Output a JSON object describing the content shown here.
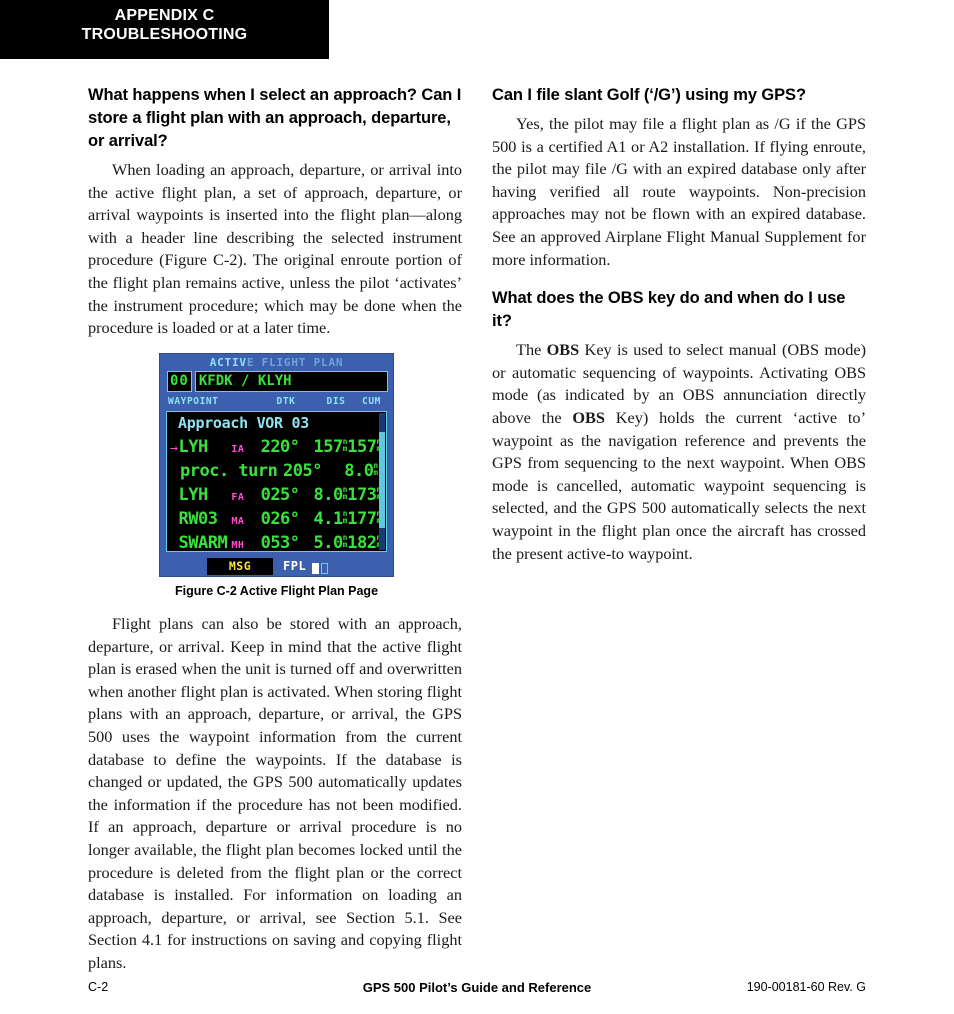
{
  "header": {
    "line1": "APPENDIX C",
    "line2": "TROUBLESHOOTING"
  },
  "left_column": {
    "heading1": "What happens when I select an approach? Can I store a flight plan with an approach, departure, or arrival?",
    "paragraph1": "When loading an approach, departure, or arrival into the active flight plan, a set of approach, departure, or arrival waypoints is inserted into the flight plan—along with a header line describing the selected instrument procedure (Figure C-2).  The original enroute portion of the flight plan remains active, unless the pilot ‘activates’ the instrument procedure; which may be done when the procedure is loaded or at a later time.",
    "paragraph2": "Flight plans can also be stored with an approach, departure, or arrival.  Keep in mind that the active flight plan is erased when the unit is turned off and overwritten when another flight plan is activated.  When storing flight plans with an approach, departure, or arrival, the GPS 500 uses the waypoint information from the current database to define the waypoints.  If the database is changed or updated, the GPS 500 automatically updates the information if the procedure has not been modified.  If an approach, departure or arrival procedure is no longer available, the flight plan becomes locked until the procedure is deleted from the flight plan or the correct database is installed.  For information on loading an approach, departure, or arrival, see Section 5.1.  See Section 4.1 for instructions on saving and copying flight plans."
  },
  "right_column": {
    "heading1": "Can I file slant Golf (‘/G’) using my GPS?",
    "paragraph1": "Yes, the pilot may file a flight plan as /G if the GPS 500 is a certified A1 or A2 installation.  If flying enroute, the pilot may file /G with an expired database only after having verified all route waypoints.   Non-precision approaches may not be flown with an expired database.  See an approved Airplane Flight Manual Supplement for more information.",
    "heading2": "What does the OBS key do and when do I use it?",
    "paragraph2_part1": "The ",
    "paragraph2_bold1": "OBS",
    "paragraph2_part2": " Key is used to select manual (OBS mode) or automatic sequencing of waypoints.  Activating OBS mode (as indicated by an OBS annunciation directly above the ",
    "paragraph2_bold2": "OBS",
    "paragraph2_part3": " Key) holds the current ‘active to’ waypoint as the navigation reference and prevents the GPS from sequencing to the next waypoint.  When OBS mode is cancelled, automatic waypoint sequencing is selected, and the GPS 500 automatically selects the next waypoint in the flight plan once the aircraft has crossed the present active-to waypoint."
  },
  "figure": {
    "caption": "Figure C-2  Active Flight Plan Page",
    "gps": {
      "title_active": "ACTIV",
      "title_rest": "E FLIGHT PLAN",
      "plan_number": "00",
      "route": "KFDK / KLYH",
      "columns": {
        "waypoint": "WAYPOINT",
        "dtk": "DTK",
        "dis": "DIS",
        "cum": "CUM"
      },
      "procedure_header": "Approach VOR 03",
      "rows": [
        {
          "arrow": "→",
          "waypoint": "LYH",
          "type": "IA",
          "dtk": "220°",
          "dis": "157",
          "dis_unit_top": "n",
          "dis_unit_bottom": "m",
          "cum": "157",
          "cum_unit_top": "n",
          "cum_unit_bottom": "m"
        },
        {
          "arrow": "",
          "waypoint": "proc. turn",
          "type": "",
          "dtk": "205°",
          "dis": "8.0",
          "dis_unit_top": "n",
          "dis_unit_bottom": "m",
          "cum": "",
          "cum_unit_top": "",
          "cum_unit_bottom": ""
        },
        {
          "arrow": "",
          "waypoint": "LYH",
          "type": "FA",
          "dtk": "025°",
          "dis": "8.0",
          "dis_unit_top": "n",
          "dis_unit_bottom": "m",
          "cum": "173",
          "cum_unit_top": "n",
          "cum_unit_bottom": "m"
        },
        {
          "arrow": "",
          "waypoint": "RW03",
          "type": "MA",
          "dtk": "026°",
          "dis": "4.1",
          "dis_unit_top": "n",
          "dis_unit_bottom": "m",
          "cum": "177",
          "cum_unit_top": "n",
          "cum_unit_bottom": "m"
        },
        {
          "arrow": "",
          "waypoint": "SWARM",
          "type": "MH",
          "dtk": "053°",
          "dis": "5.0",
          "dis_unit_top": "n",
          "dis_unit_bottom": "m",
          "cum": "182",
          "cum_unit_top": "n",
          "cum_unit_bottom": "m"
        }
      ],
      "status": {
        "msg": "MSG",
        "page_group": "FPL"
      },
      "colors": {
        "screen_background": "#3c5fae",
        "list_background": "#000000",
        "text_green": "#3ce03c",
        "text_cyan": "#8fe3f0",
        "text_magenta": "#ff4fd0",
        "text_yellow": "#f6e33a",
        "border_cyan": "#5fd2e6"
      }
    }
  },
  "footer": {
    "left": "C-2",
    "center": "GPS 500 Pilot’s Guide and Reference",
    "right": "190-00181-60  Rev. G"
  }
}
